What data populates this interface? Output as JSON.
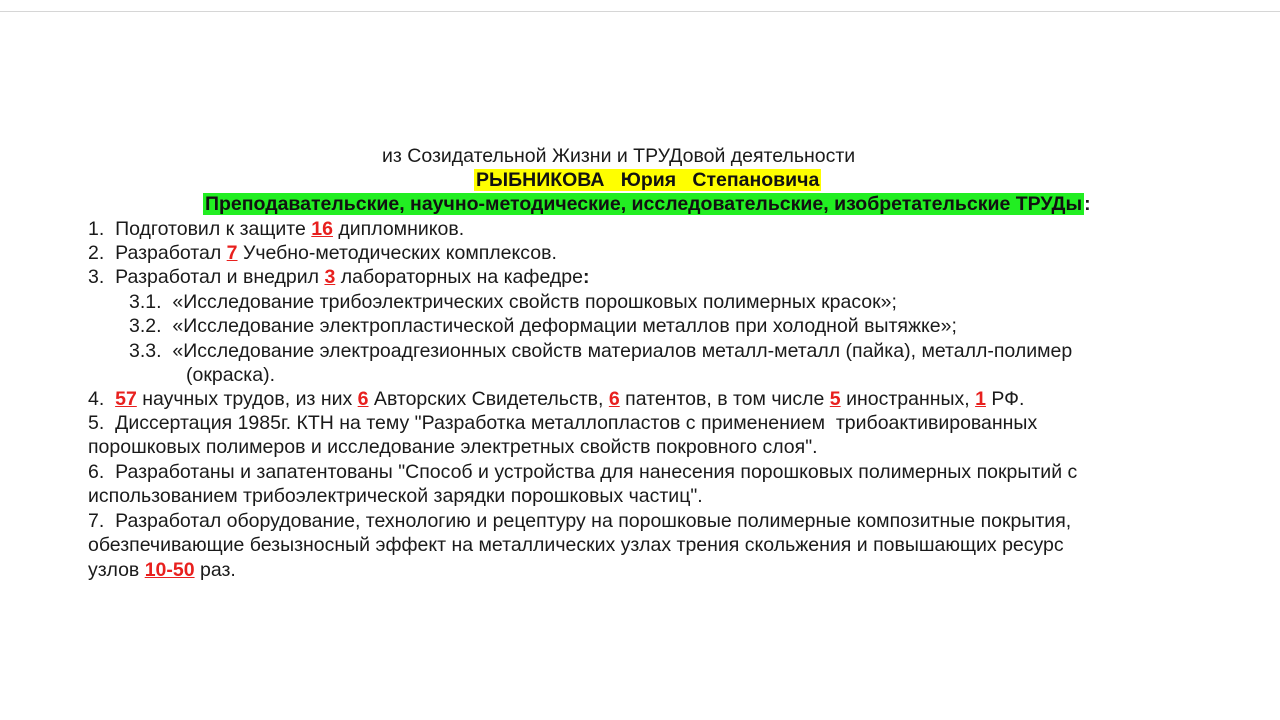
{
  "heading": {
    "intro": "из Созидательной Жизни и ТРУДовой деятельности",
    "name": "РЫБНИКОВА   Юрия   Степановича",
    "subtitle": "Преподавательские, научно-методические, исследовательские, изобретательские ТРУДы",
    "subtitle_colon": ":"
  },
  "items": {
    "i1": {
      "num": "1.",
      "pre": "Подготовил к защите ",
      "n": "16",
      "post": " дипломников."
    },
    "i2": {
      "num": "2.",
      "pre": "Разработал ",
      "n": "7",
      "post": " Учебно-методических комплексов."
    },
    "i3": {
      "num": "3.",
      "pre": "Разработал и внедрил ",
      "n": "3",
      "post": " лабораторных на кафедре",
      "colon": ":"
    },
    "s31": {
      "num": "3.1.",
      "text": "«Исследование трибоэлектрических свойств порошковых полимерных красок»;"
    },
    "s32": {
      "num": "3.2.",
      "text": "«Исследование электропластической деформации металлов при холодной вытяжке»;"
    },
    "s33": {
      "num": "3.3.",
      "text": "«Исследование электроадгезионных свойств материалов металл-металл (пайка), металл-полимер",
      "cont": "(окраска)."
    },
    "i4": {
      "num": "4.",
      "n1": "57",
      "t1": " научных трудов, из них ",
      "n2": "6",
      "t2": " Авторских Свидетельств, ",
      "n3": "6",
      "t3": " патентов, в том числе ",
      "n4": "5",
      "t4": " иностранных, ",
      "n5": "1",
      "t5": " РФ."
    },
    "i5": {
      "num": "5.",
      "l1": "Диссертация 1985г. КТН на тему \"Разработка металлопластов с применением  трибоактивированных",
      "l2": "порошковых полимеров и исследование электретных свойств покровного слоя\"."
    },
    "i6": {
      "num": "6.",
      "l1": "Разработаны и запатентованы \"Способ и устройства для нанесения порошковых полимерных покрытий с",
      "l2": "использованием трибоэлектрической зарядки порошковых частиц\"."
    },
    "i7": {
      "num": "7.",
      "l1": "Разработал оборудование, технологию и рецептуру на порошковые полимерные композитные покрытия,",
      "l2": "обезпечивающие безызносный эффект на металлических узлах трения скольжения и повышающих ресурс",
      "l3_pre": "узлов ",
      "n": "10-50",
      "l3_post": " раз."
    }
  }
}
